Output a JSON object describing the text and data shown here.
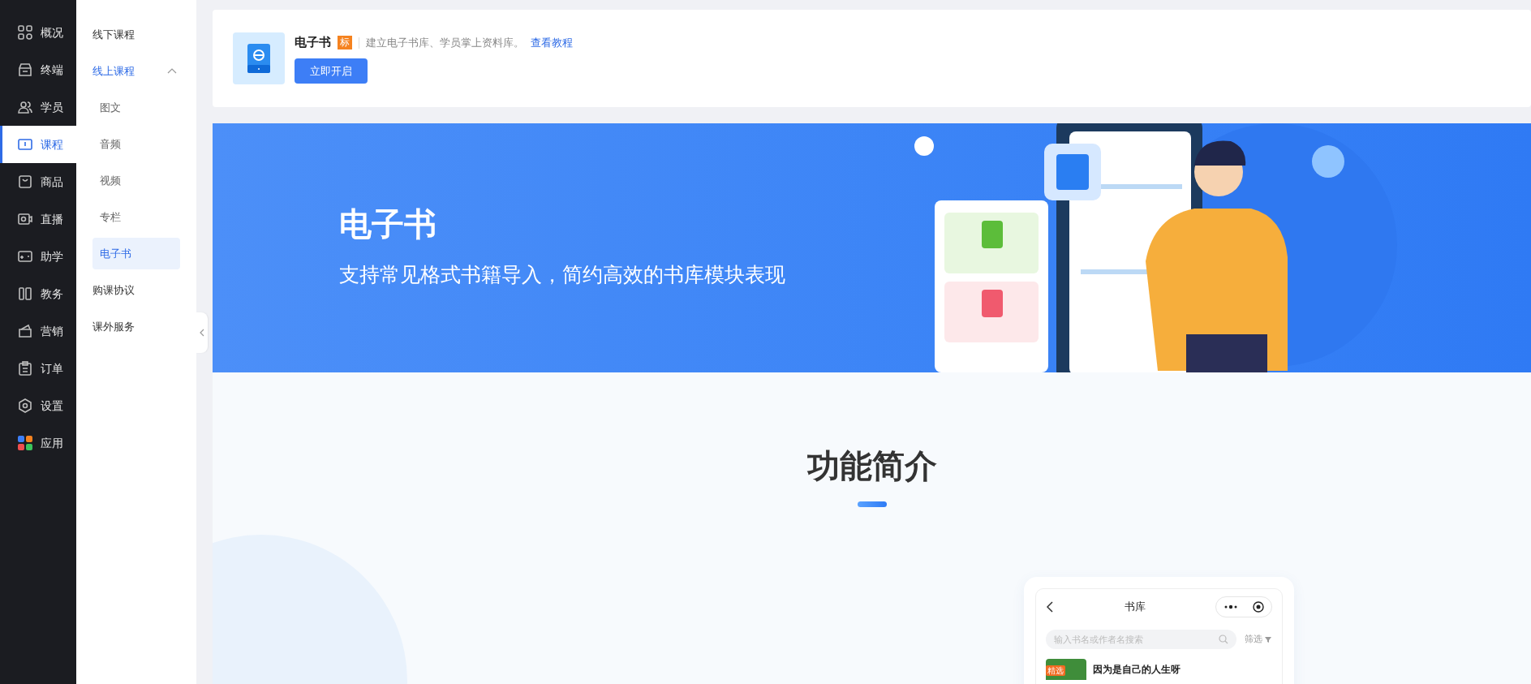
{
  "rail": {
    "items": [
      {
        "label": "概况",
        "selected": false
      },
      {
        "label": "终端",
        "selected": false
      },
      {
        "label": "学员",
        "selected": false
      },
      {
        "label": "课程",
        "selected": true
      },
      {
        "label": "商品",
        "selected": false
      },
      {
        "label": "直播",
        "selected": false
      },
      {
        "label": "助学",
        "selected": false
      },
      {
        "label": "教务",
        "selected": false
      },
      {
        "label": "营销",
        "selected": false
      },
      {
        "label": "订单",
        "selected": false
      },
      {
        "label": "设置",
        "selected": false
      },
      {
        "label": "应用",
        "selected": false
      }
    ]
  },
  "subnav": {
    "items": [
      {
        "label": "线下课程",
        "selected": false
      },
      {
        "label": "线上课程",
        "selected": false,
        "expanded": true,
        "children": [
          {
            "label": "图文",
            "selected": false
          },
          {
            "label": "音频",
            "selected": false
          },
          {
            "label": "视频",
            "selected": false
          },
          {
            "label": "专栏",
            "selected": false
          },
          {
            "label": "电子书",
            "selected": true
          }
        ]
      },
      {
        "label": "购课协议",
        "selected": false
      },
      {
        "label": "课外服务",
        "selected": false
      }
    ]
  },
  "app_card": {
    "title": "电子书",
    "badge": "标",
    "description": "建立电子书库、学员掌上资料库。",
    "link": "查看教程",
    "button": "立即开启"
  },
  "banner": {
    "title": "电子书",
    "subtitle": "支持常见格式书籍导入，简约高效的书库模块表现"
  },
  "intro": {
    "heading": "功能简介"
  },
  "phone": {
    "title": "书库",
    "search": {
      "placeholder": "输入书名或作者名搜索"
    },
    "filter": "筛选",
    "books": [
      {
        "tag": "精选",
        "title": "因为是自己的人生呀"
      }
    ]
  }
}
